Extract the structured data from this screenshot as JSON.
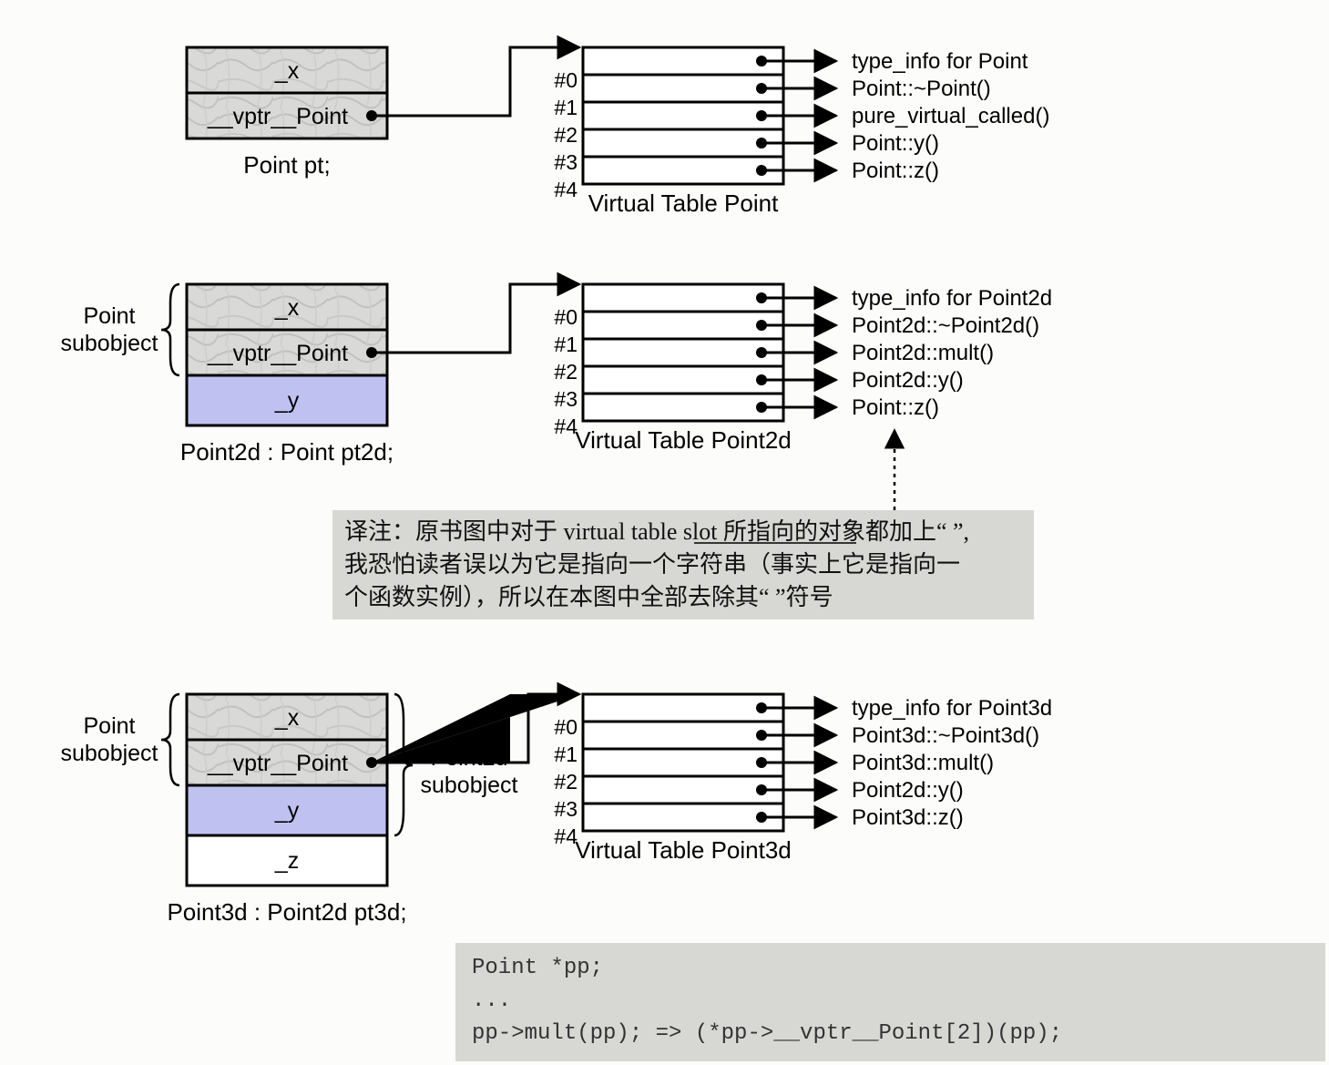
{
  "section1": {
    "fields": {
      "x": "_x",
      "vptr": "__vptr__Point"
    },
    "caption": "Point pt;",
    "vtable": {
      "caption": "Virtual Table Point",
      "slots": [
        "#0",
        "#1",
        "#2",
        "#3",
        "#4"
      ],
      "entries": [
        "type_info for Point",
        "Point::~Point()",
        "pure_virtual_called()",
        "Point::y()",
        "Point::z()"
      ]
    }
  },
  "section2": {
    "subobject_label1": "Point",
    "subobject_label2": "subobject",
    "fields": {
      "x": "_x",
      "vptr": "__vptr__Point",
      "y": "_y"
    },
    "caption": "Point2d : Point pt2d;",
    "vtable": {
      "caption": "Virtual Table Point2d",
      "slots": [
        "#0",
        "#1",
        "#2",
        "#3",
        "#4"
      ],
      "entries": [
        "type_info for Point2d",
        "Point2d::~Point2d()",
        "Point2d::mult()",
        "Point2d::y()",
        "Point::z()"
      ]
    }
  },
  "note": {
    "line1": "译注：原书图中对于 virtual table slot 所指向的对象都加上“ ”,",
    "underline_word": "所指向的对象",
    "line2": "我恐怕读者误以为它是指向一个字符串（事实上它是指向一",
    "line3": "个函数实例），所以在本图中全部去除其“ ”符号"
  },
  "section3": {
    "subobject1_label1": "Point",
    "subobject1_label2": "subobject",
    "subobject2_label1": "Point2d",
    "subobject2_label2": "subobject",
    "fields": {
      "x": "_x",
      "vptr": "__vptr__Point",
      "y": "_y",
      "z": "_z"
    },
    "caption": "Point3d : Point2d pt3d;",
    "vtable": {
      "caption": "Virtual Table Point3d",
      "slots": [
        "#0",
        "#1",
        "#2",
        "#3",
        "#4"
      ],
      "entries": [
        "type_info for Point3d",
        "Point3d::~Point3d()",
        "Point3d::mult()",
        "Point2d::y()",
        "Point3d::z()"
      ]
    }
  },
  "code": {
    "line1": "Point *pp;",
    "line2": "...",
    "line3": "pp->mult(pp); => (*pp->__vptr__Point[2])(pp);"
  }
}
